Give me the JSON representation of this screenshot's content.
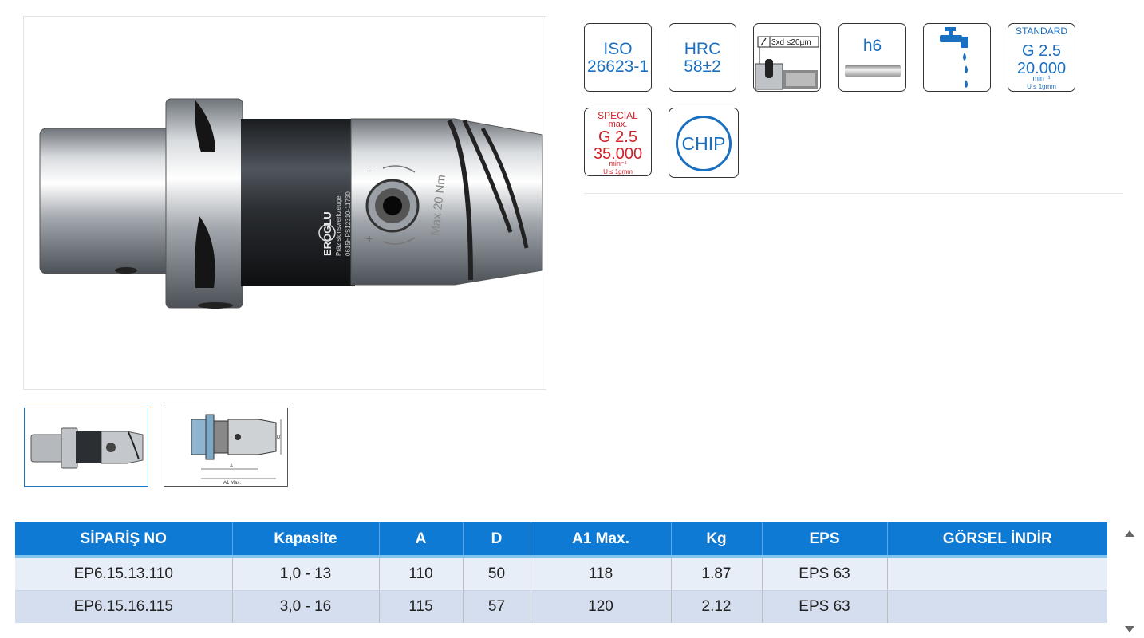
{
  "product": {
    "engraving_brand": "EROGLU",
    "engraving_sub": "Präzisionswerkzeuge",
    "engraving_code": "0615HPS12310-11730",
    "torque_text": "Max 20 Nm"
  },
  "badges": {
    "iso": {
      "line1": "ISO",
      "line2": "26623-1"
    },
    "hrc": {
      "line1": "HRC",
      "line2": "58±2"
    },
    "runout": {
      "label": "3xd ≤20µm"
    },
    "h6": {
      "label": "h6"
    },
    "coolant": {
      "icon": "coolant-tap-icon"
    },
    "standard": {
      "top": "STANDARD",
      "grade": "G 2.5",
      "rpm": "20.000",
      "unit": "min⁻¹",
      "tol": "U ≤ 1gmm"
    },
    "special": {
      "top": "SPECIAL",
      "max": "max.",
      "grade": "G 2.5",
      "rpm": "35.000",
      "unit": "min⁻¹",
      "tol": "U ≤ 1gmm"
    },
    "chip": {
      "label": "CHIP"
    }
  },
  "drawing": {
    "dim_a": "A",
    "dim_a1": "A1 Max.",
    "dim_d": "D"
  },
  "table": {
    "headers": [
      "SİPARİŞ NO",
      "Kapasite",
      "A",
      "D",
      "A1 Max.",
      "Kg",
      "EPS",
      "GÖRSEL İNDİR"
    ],
    "rows": [
      [
        "EP6.15.13.110",
        "1,0 - 13",
        "110",
        "50",
        "118",
        "1.87",
        "EPS 63",
        ""
      ],
      [
        "EP6.15.16.115",
        "3,0 - 16",
        "115",
        "57",
        "120",
        "2.12",
        "EPS 63",
        ""
      ]
    ]
  },
  "colors": {
    "header_blue": "#0f7ad4",
    "icon_blue": "#1a6fc0",
    "special_red": "#d0202a",
    "row_light": "#e8eef8",
    "row_dark": "#d5deee"
  }
}
